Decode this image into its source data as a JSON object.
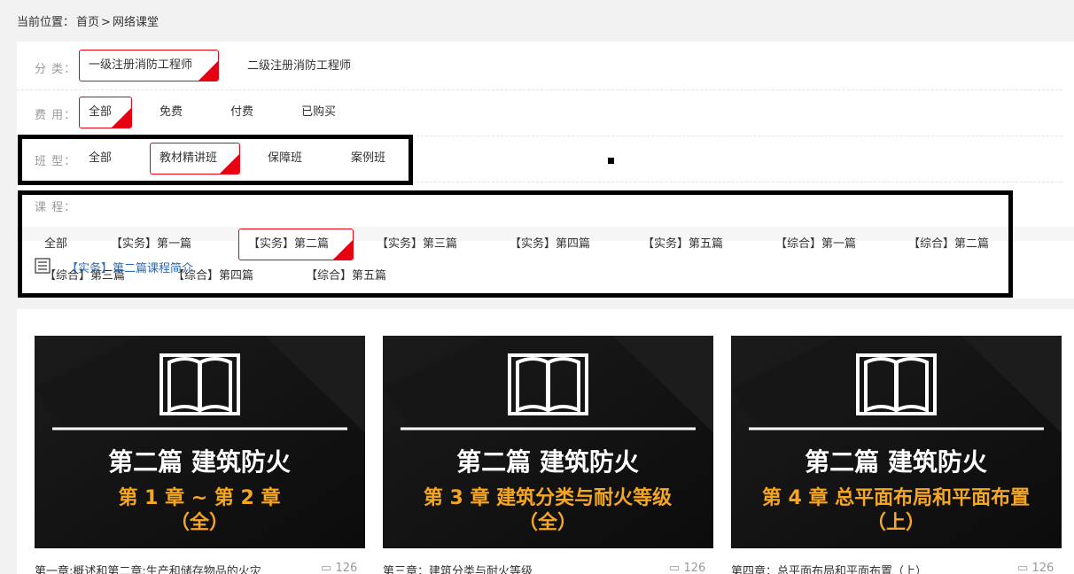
{
  "breadcrumb": {
    "prefix": "当前位置：",
    "home": "首页",
    "sep": ">",
    "current": "网络课堂"
  },
  "filters": {
    "category": {
      "label": "分 类：",
      "options": [
        "一级注册消防工程师",
        "二级注册消防工程师"
      ],
      "active_index": 0
    },
    "fee": {
      "label": "费 用：",
      "options": [
        "全部",
        "免费",
        "付费",
        "已购买"
      ],
      "active_index": 0
    },
    "class_type": {
      "label": "班 型：",
      "options": [
        "全部",
        "教材精讲班",
        "保障班",
        "案例班"
      ],
      "active_index": 1
    },
    "course": {
      "label": "课 程：",
      "options": [
        "全部",
        "【实务】第一篇",
        "【实务】第二篇",
        "【实务】第三篇",
        "【实务】第四篇",
        "【实务】第五篇",
        "【综合】第一篇",
        "【综合】第二篇",
        "【综合】第三篇",
        "【综合】第四篇",
        "【综合】第五篇"
      ],
      "active_index": 2
    },
    "intro_link": "【实务】第二篇课程简介"
  },
  "cards": [
    {
      "part_title": "第二篇  建筑防火",
      "chapter_line1": "第 1 章 ~ 第 2 章",
      "chapter_line2": "（全）",
      "caption": "第一章:概述和第二章:生产和储存物品的火灾",
      "count": "126"
    },
    {
      "part_title": "第二篇  建筑防火",
      "chapter_line1": "第 3 章  建筑分类与耐火等级",
      "chapter_line2": "（全）",
      "caption": "第三章：建筑分类与耐火等级",
      "count": "126"
    },
    {
      "part_title": "第二篇  建筑防火",
      "chapter_line1": "第 4 章  总平面布局和平面布置",
      "chapter_line2": "（上）",
      "caption": "第四章：总平面布局和平面布置（上）",
      "count": "126"
    }
  ],
  "colors": {
    "accent_red": "#e60012",
    "chapter_orange": "#f5a623",
    "link_blue": "#2a6bb8",
    "card_bg": "#111111"
  },
  "icons": {
    "list": "list-icon",
    "book": "book-icon",
    "comment": "comment-icon"
  }
}
